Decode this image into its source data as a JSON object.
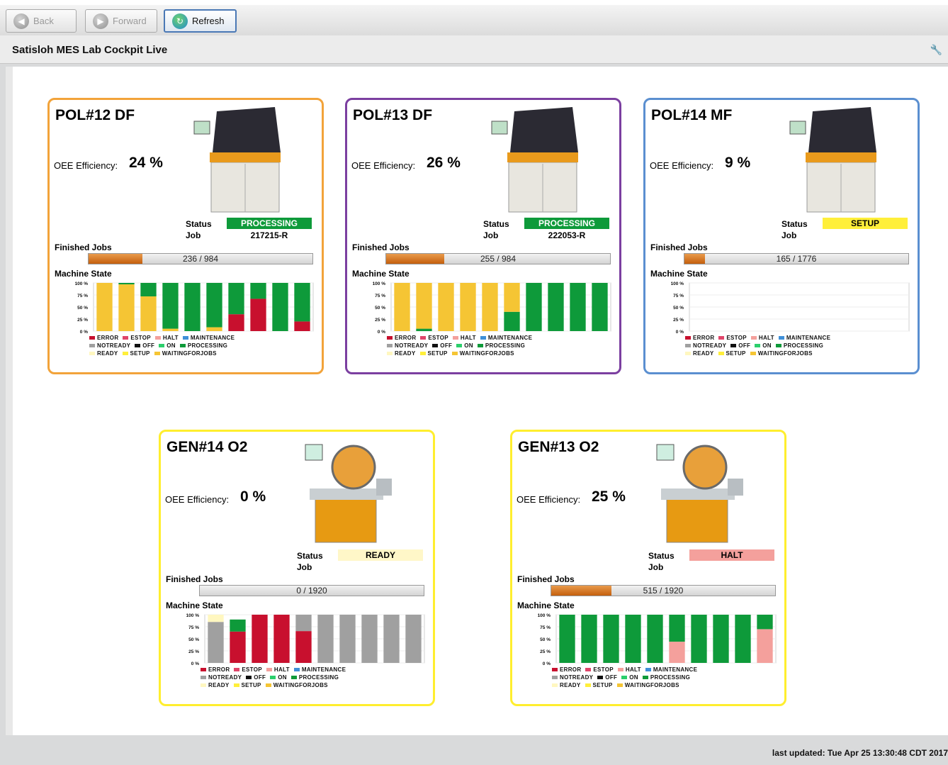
{
  "toolbar": {
    "back_label": "Back",
    "forward_label": "Forward",
    "refresh_label": "Refresh"
  },
  "title": "Satisloh MES Lab Cockpit Live",
  "footer": {
    "last_updated": "last updated: Tue Apr 25 13:30:48 CDT 2017"
  },
  "labels": {
    "oee": "OEE Efficiency:",
    "status": "Status",
    "job": "Job",
    "finished_jobs": "Finished Jobs",
    "machine_state": "Machine State"
  },
  "legend": [
    [
      {
        "label": "ERROR",
        "color": "#c8102e"
      },
      {
        "label": "ESTOP",
        "color": "#e0456a"
      },
      {
        "label": "HALT",
        "color": "#f4a09c"
      },
      {
        "label": "MAINTENANCE",
        "color": "#3f8fd8"
      }
    ],
    [
      {
        "label": "NOTREADY",
        "color": "#a0a0a0"
      },
      {
        "label": "OFF",
        "color": "#111111"
      },
      {
        "label": "ON",
        "color": "#2ccf6c"
      },
      {
        "label": "PROCESSING",
        "color": "#0e9a3a"
      }
    ],
    [
      {
        "label": "READY",
        "color": "#fff7c0"
      },
      {
        "label": "SETUP",
        "color": "#ffef3a"
      },
      {
        "label": "WAITINGFORJOBS",
        "color": "#f5c534"
      }
    ]
  ],
  "machines": [
    {
      "name": "POL#12 DF",
      "oee": "24 %",
      "status": "PROCESSING",
      "status_color": "#0e9a3a",
      "status_text_color": "#ffffff",
      "job": "217215-R",
      "finished_jobs": "236 / 984",
      "progress": 0.24,
      "border_color": "#f2a33a",
      "machine_icon": "polisher-machine-image"
    },
    {
      "name": "POL#13 DF",
      "oee": "26 %",
      "status": "PROCESSING",
      "status_color": "#0e9a3a",
      "status_text_color": "#ffffff",
      "job": "222053-R",
      "finished_jobs": "255 / 984",
      "progress": 0.26,
      "border_color": "#7b3fa0",
      "machine_icon": "polisher-machine-image"
    },
    {
      "name": "POL#14 MF",
      "oee": "9 %",
      "status": "SETUP",
      "status_color": "#ffef3a",
      "status_text_color": "#000000",
      "job": "",
      "finished_jobs": "165 / 1776",
      "progress": 0.093,
      "border_color": "#5b8fd0",
      "machine_icon": "polisher-machine-image"
    },
    {
      "name": "GEN#14 O2",
      "oee": "0 %",
      "status": "READY",
      "status_color": "#fff7c8",
      "status_text_color": "#000000",
      "job": "",
      "finished_jobs": "0 / 1920",
      "progress": 0,
      "border_color": "#ffee2e",
      "machine_icon": "generator-machine-image"
    },
    {
      "name": "GEN#13 O2",
      "oee": "25 %",
      "status": "HALT",
      "status_color": "#f4a09c",
      "status_text_color": "#000000",
      "job": "",
      "finished_jobs": "515 / 1920",
      "progress": 0.268,
      "border_color": "#ffee2e",
      "machine_icon": "generator-machine-image"
    }
  ],
  "chart_data": [
    {
      "type": "bar",
      "title": "Machine State",
      "stacked": true,
      "ylim": [
        0,
        100
      ],
      "yticks": [
        "100 %",
        "75 %",
        "50 %",
        "25 %",
        "0 %"
      ],
      "series": [
        {
          "name": "ERROR",
          "color": "#c8102e",
          "values": [
            0,
            0,
            0,
            0,
            0,
            0,
            35,
            67,
            0,
            20
          ]
        },
        {
          "name": "WAITINGFORJOBS",
          "color": "#f5c534",
          "values": [
            100,
            97,
            72,
            5,
            0,
            8,
            0,
            0,
            0,
            0
          ]
        },
        {
          "name": "PROCESSING",
          "color": "#0e9a3a",
          "values": [
            0,
            3,
            28,
            95,
            100,
            92,
            65,
            33,
            100,
            80
          ]
        }
      ]
    },
    {
      "type": "bar",
      "title": "Machine State",
      "stacked": true,
      "ylim": [
        0,
        100
      ],
      "yticks": [
        "100 %",
        "75 %",
        "50 %",
        "25 %",
        "0 %"
      ],
      "series": [
        {
          "name": "PROCESSING",
          "color": "#0e9a3a",
          "values": [
            0,
            5,
            0,
            0,
            0,
            40,
            100,
            100,
            100,
            100
          ]
        },
        {
          "name": "WAITINGFORJOBS",
          "color": "#f5c534",
          "values": [
            100,
            95,
            100,
            100,
            100,
            60,
            0,
            0,
            0,
            0
          ]
        }
      ]
    },
    {
      "type": "bar",
      "title": "Machine State",
      "stacked": true,
      "ylim": [
        0,
        100
      ],
      "yticks": [
        "100 %",
        "75 %",
        "50 %",
        "25 %",
        "0 %"
      ],
      "series": []
    },
    {
      "type": "bar",
      "title": "Machine State",
      "stacked": true,
      "ylim": [
        0,
        100
      ],
      "yticks": [
        "100 %",
        "75 %",
        "50 %",
        "25 %",
        "0 %"
      ],
      "series": [
        {
          "name": "ERROR",
          "color": "#c8102e",
          "values": [
            0,
            65,
            100,
            100,
            66,
            0,
            0,
            0,
            0,
            0
          ]
        },
        {
          "name": "PROCESSING",
          "color": "#0e9a3a",
          "values": [
            0,
            25,
            0,
            0,
            0,
            0,
            0,
            0,
            0,
            0
          ]
        },
        {
          "name": "NOTREADY",
          "color": "#a0a0a0",
          "values": [
            85,
            0,
            0,
            0,
            34,
            100,
            100,
            100,
            100,
            100
          ]
        },
        {
          "name": "READY",
          "color": "#fff7c0",
          "values": [
            15,
            0,
            0,
            0,
            0,
            0,
            0,
            0,
            0,
            0
          ]
        }
      ]
    },
    {
      "type": "bar",
      "title": "Machine State",
      "stacked": true,
      "ylim": [
        0,
        100
      ],
      "yticks": [
        "100 %",
        "75 %",
        "50 %",
        "25 %",
        "0 %"
      ],
      "series": [
        {
          "name": "HALT",
          "color": "#f4a09c",
          "values": [
            0,
            0,
            0,
            0,
            0,
            44,
            0,
            0,
            0,
            70
          ]
        },
        {
          "name": "PROCESSING",
          "color": "#0e9a3a",
          "values": [
            100,
            100,
            100,
            100,
            100,
            56,
            100,
            100,
            100,
            30
          ]
        }
      ]
    }
  ]
}
